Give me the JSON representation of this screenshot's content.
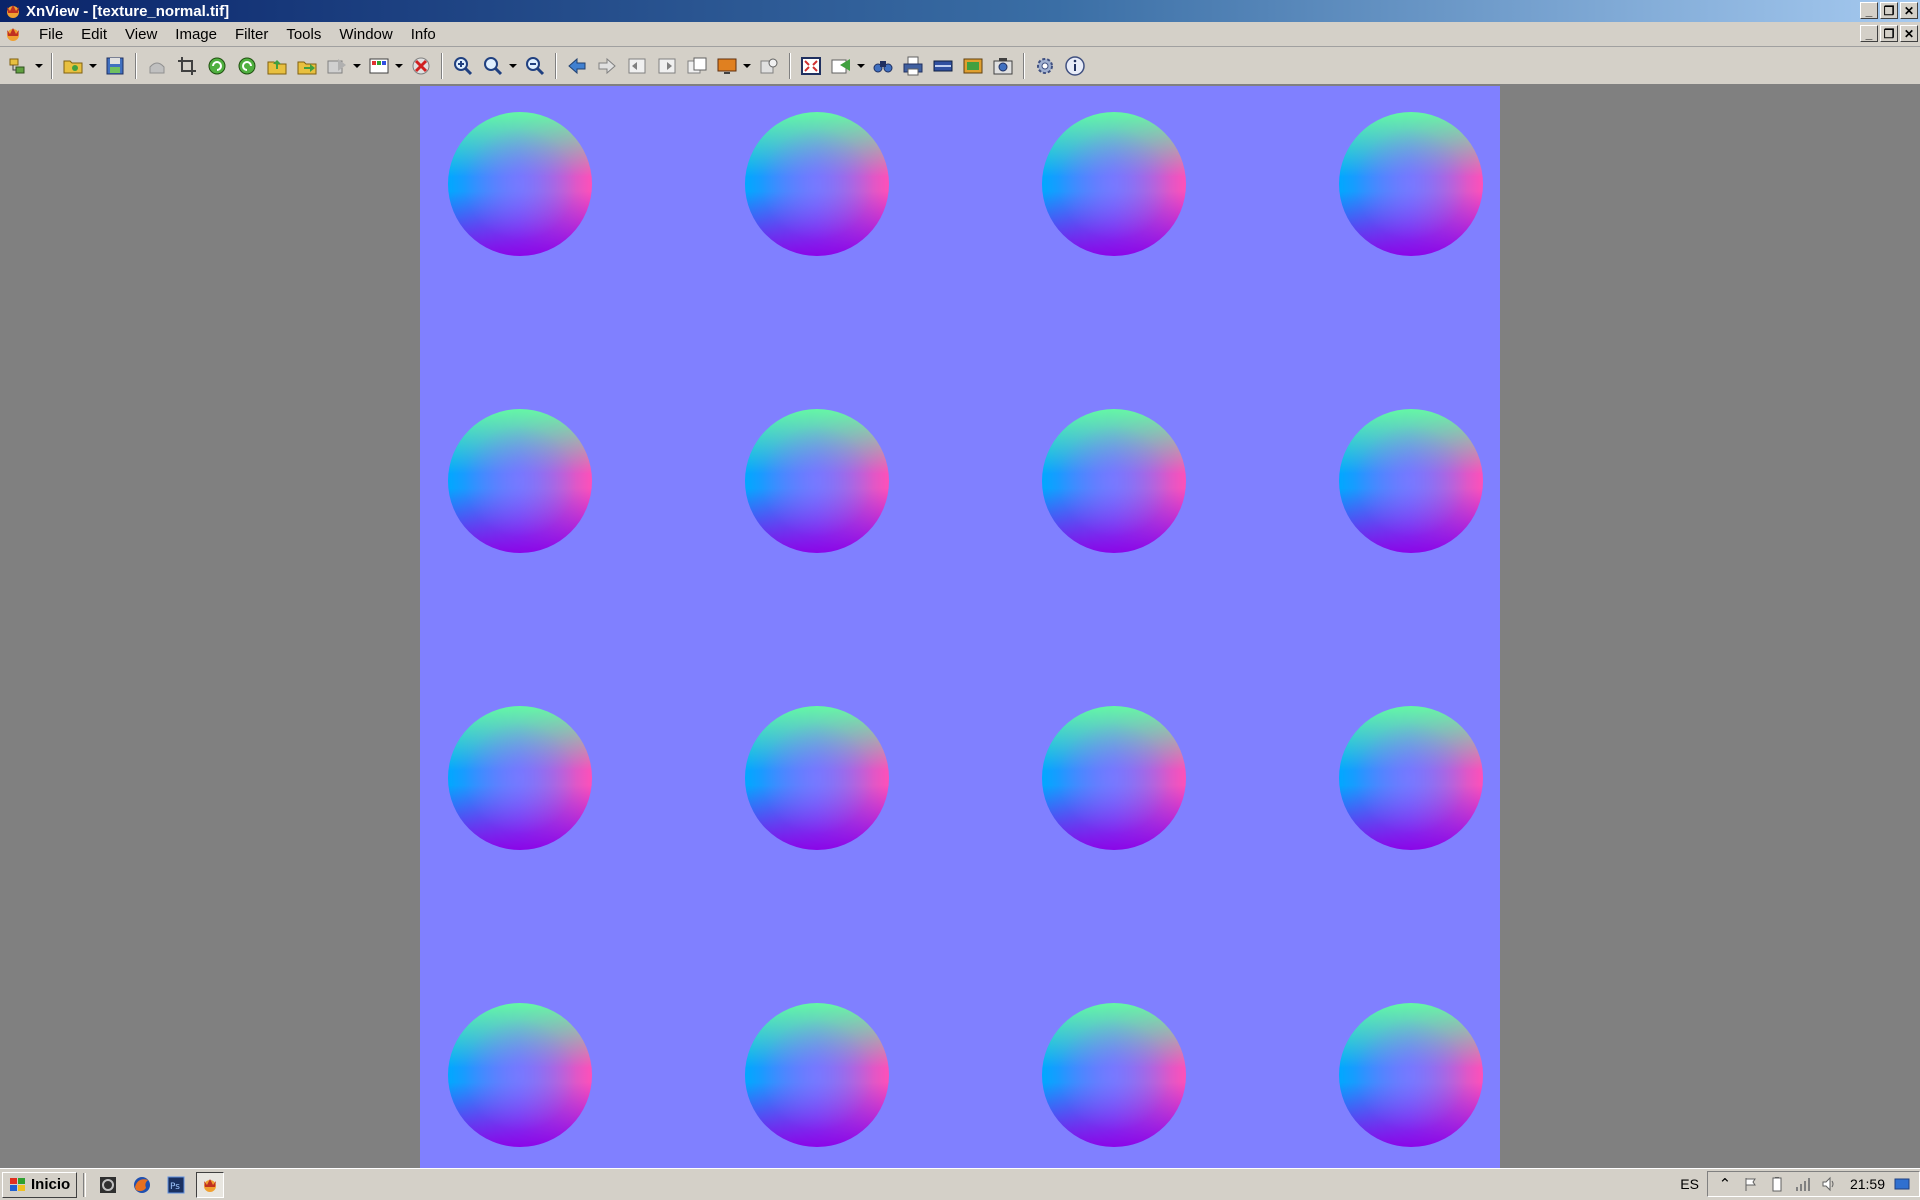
{
  "window": {
    "title": "XnView - [texture_normal.tif]",
    "title_icon": "xnview-icon",
    "buttons": [
      "minimize-icon",
      "restore-icon",
      "close-icon"
    ]
  },
  "menu": {
    "items": [
      {
        "label": "File"
      },
      {
        "label": "Edit"
      },
      {
        "label": "View"
      },
      {
        "label": "Image"
      },
      {
        "label": "Filter"
      },
      {
        "label": "Tools"
      },
      {
        "label": "Window"
      },
      {
        "label": "Info"
      }
    ]
  },
  "toolbar": {
    "icons": [
      "browser-icon",
      "open-icon",
      "save-icon",
      "undo-icon",
      "crop-icon",
      "rotate-left-icon",
      "rotate-right-icon",
      "copy-to-icon",
      "move-to-icon",
      "export-icon",
      "adjust-colors-icon",
      "delete-icon",
      "zoom-in-icon",
      "zoom-icon",
      "zoom-out-icon",
      "previous-icon",
      "next-icon",
      "first-icon",
      "last-icon",
      "slideshow-icon",
      "display-icon",
      "fullscreen-icon",
      "fit-icon",
      "capture-icon",
      "find-icon",
      "print-icon",
      "scan-icon",
      "wallpaper-icon",
      "screenshot-icon",
      "settings-icon",
      "info-icon"
    ]
  },
  "image": {
    "file": "texture_normal.tif",
    "background_color": "#8080ff",
    "grid": {
      "rows": 4,
      "cols": 4
    }
  },
  "taskbar": {
    "start_label": "Inicio",
    "quick_launch": [
      "app-icon",
      "firefox-icon",
      "photoshop-icon",
      "xnview-icon"
    ],
    "language": "ES",
    "clock": "21:59",
    "tray_icons": [
      "expand-icon",
      "flag-icon",
      "battery-icon",
      "network-icon",
      "volume-icon",
      "desktop-icon"
    ]
  }
}
